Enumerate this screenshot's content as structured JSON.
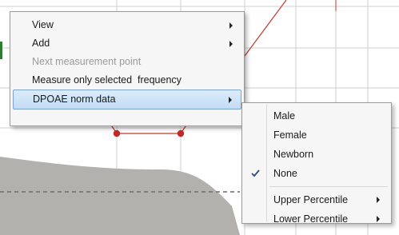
{
  "context_menu": {
    "items": [
      {
        "label": "View",
        "enabled": true,
        "submenu": true
      },
      {
        "label": "Add",
        "enabled": true,
        "submenu": true
      },
      {
        "label": "Next measurement point",
        "enabled": false,
        "submenu": false
      },
      {
        "label": "Measure only selected  frequency",
        "enabled": true,
        "submenu": false
      },
      {
        "label": "DPOAE norm data",
        "enabled": true,
        "submenu": true,
        "highlighted": true
      }
    ]
  },
  "norm_data_submenu": {
    "items": [
      {
        "label": "Male",
        "checked": false
      },
      {
        "label": "Female",
        "checked": false
      },
      {
        "label": "Newborn",
        "checked": false
      },
      {
        "label": "None",
        "checked": true
      },
      {
        "label": "Upper Percentile",
        "submenu": true
      },
      {
        "label": "Lower Percentile",
        "submenu": true
      }
    ]
  },
  "icons": {
    "submenu_arrow": "chevron-right-icon",
    "selected_check": "checkmark-icon"
  },
  "colors": {
    "highlight_top": "#dcecfc",
    "highlight_bottom": "#c2dcf4",
    "highlight_border": "#7da2ce",
    "data_line": "#c0392b",
    "norm_area": "#b3b1ae"
  }
}
